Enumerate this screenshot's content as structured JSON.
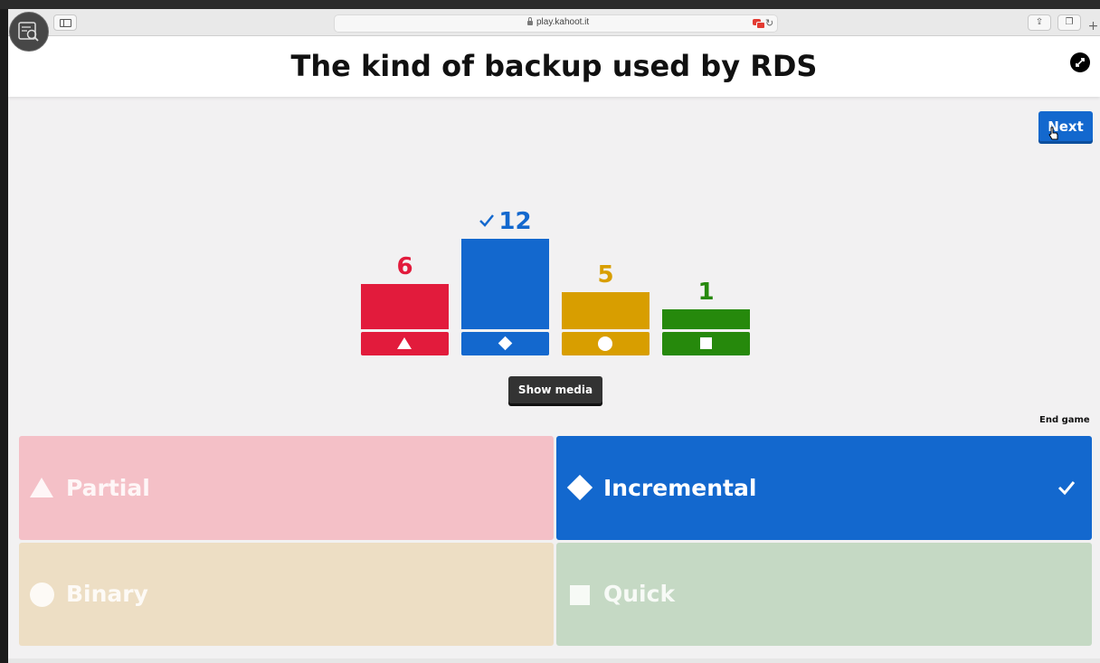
{
  "browser": {
    "url": "play.kahoot.it"
  },
  "question": {
    "title": "The kind of backup used by RDS"
  },
  "controls": {
    "next_label": "Next",
    "show_media_label": "Show media",
    "end_game_label": "End game"
  },
  "colors": {
    "red": "#e21b3c",
    "blue": "#1368ce",
    "yellow": "#d89e00",
    "green": "#26890c"
  },
  "chart_data": {
    "type": "bar",
    "categories": [
      "Partial",
      "Incremental",
      "Binary",
      "Quick"
    ],
    "values": [
      6,
      12,
      5,
      1
    ],
    "value_labels": [
      "6",
      "12",
      "5",
      "1"
    ],
    "shapes": [
      "triangle-icon",
      "diamond-icon",
      "circle-icon",
      "square-icon"
    ],
    "colors": [
      "#e21b3c",
      "#1368ce",
      "#d89e00",
      "#26890c"
    ],
    "correct_index": 1
  },
  "answers": [
    {
      "label": "Partial",
      "icon": "triangle-icon",
      "color": "#f4c0c7",
      "correct": false
    },
    {
      "label": "Incremental",
      "icon": "diamond-icon",
      "color": "#1368ce",
      "correct": true
    },
    {
      "label": "Binary",
      "icon": "circle-icon",
      "color": "#eddec4",
      "correct": false
    },
    {
      "label": "Quick",
      "icon": "square-icon",
      "color": "#c5d9c4",
      "correct": false
    }
  ]
}
